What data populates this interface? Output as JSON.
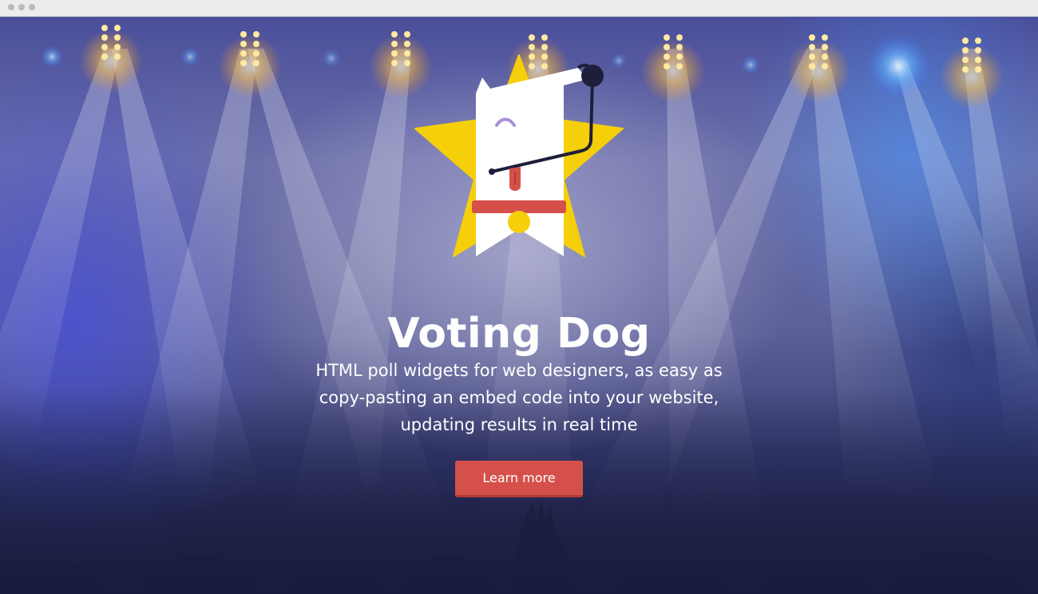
{
  "window": {
    "controls": [
      "close-dot",
      "minimize-dot",
      "zoom-dot"
    ]
  },
  "hero": {
    "logo_icon": "voting-dog-star-logo",
    "title": "Voting Dog",
    "subtitle": "HTML poll widgets for web designers, as easy as copy-pasting an embed code into your website, updating results in real time",
    "cta_label": "Learn more"
  },
  "colors": {
    "star": "#f5cf0a",
    "dog_body": "#ffffff",
    "collar": "#d5504a",
    "tag": "#f5cf0a",
    "outline": "#1d1f3a",
    "button": "#d5504a",
    "stage_lights": "#ffbf3a"
  }
}
